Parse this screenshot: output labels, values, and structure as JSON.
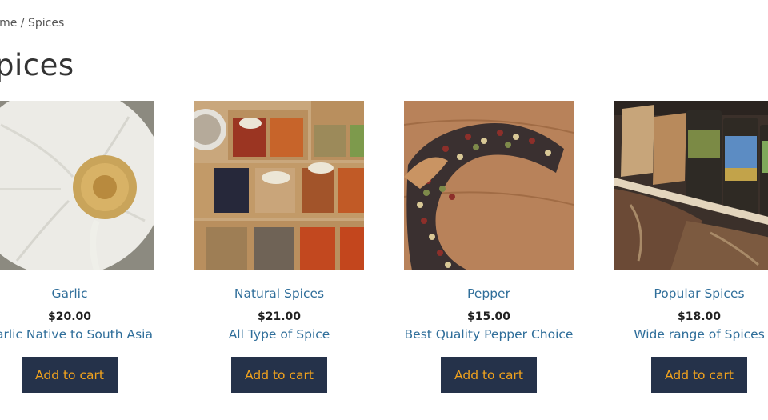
{
  "breadcrumb": {
    "home": "Home",
    "separator": " / ",
    "current": "Spices"
  },
  "page_title": "Spices",
  "products": [
    {
      "name": "Garlic",
      "price": "$20.00",
      "description": "Garlic Native to South Asia",
      "button": "Add to cart",
      "image_icon": "garlic-photo"
    },
    {
      "name": "Natural Spices",
      "price": "$21.00",
      "description": "All Type of Spice",
      "button": "Add to cart",
      "image_icon": "spice-boxes-photo"
    },
    {
      "name": "Pepper",
      "price": "$15.00",
      "description": "Best Quality Pepper Choice",
      "button": "Add to cart",
      "image_icon": "peppercorns-photo"
    },
    {
      "name": "Popular Spices",
      "price": "$18.00",
      "description": "Wide range of Spices",
      "button": "Add to cart",
      "image_icon": "spice-shelf-photo"
    }
  ],
  "colors": {
    "link": "#2f6e9a",
    "button_bg": "#25324a",
    "button_text": "#f0a21e"
  }
}
